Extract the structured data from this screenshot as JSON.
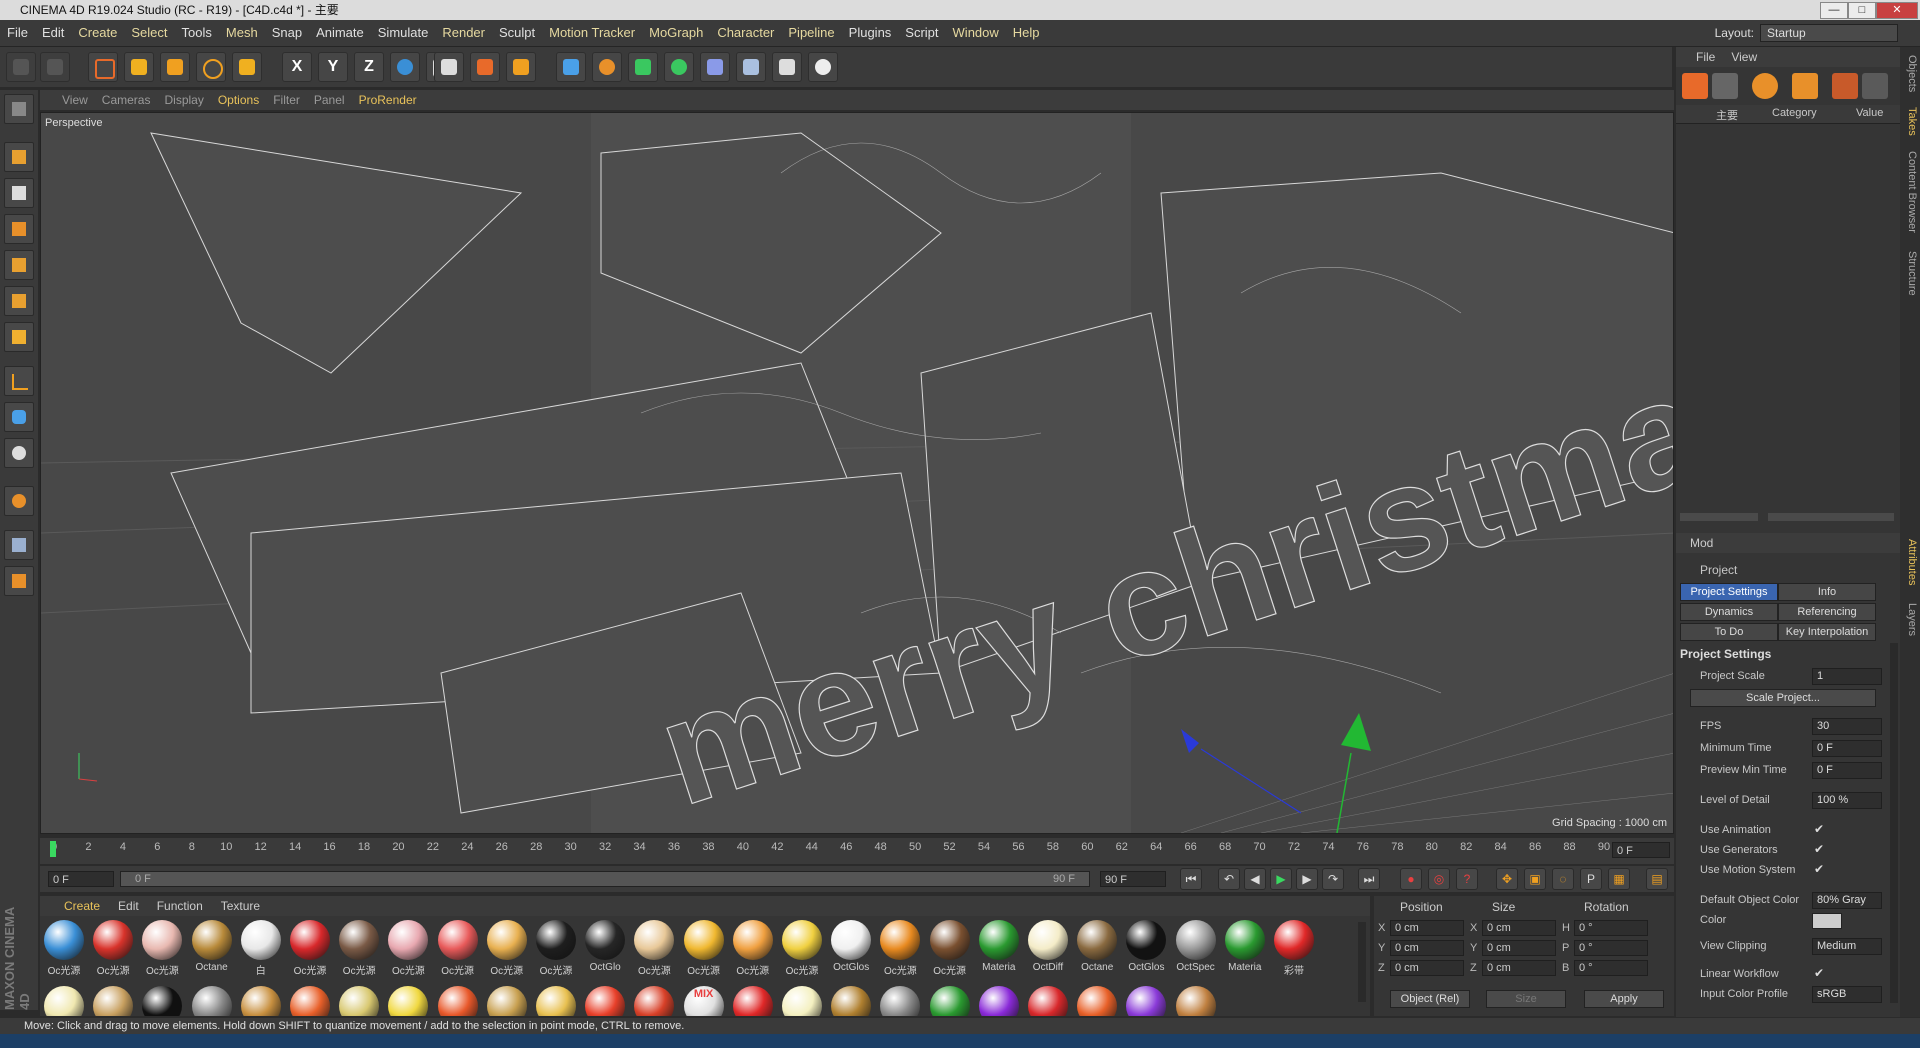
{
  "window": {
    "title": "CINEMA 4D R19.024 Studio (RC - R19) - [C4D.c4d *] - 主要",
    "controls": [
      "—",
      "□",
      "✕"
    ]
  },
  "menubar": {
    "items": [
      "File",
      "Edit",
      "Create",
      "Select",
      "Tools",
      "Mesh",
      "Snap",
      "Animate",
      "Simulate",
      "Render",
      "Sculpt",
      "Motion Tracker",
      "MoGraph",
      "Character",
      "Pipeline",
      "Plugins",
      "Script",
      "Window",
      "Help"
    ],
    "layout_label": "Layout:",
    "layout_value": "Startup"
  },
  "viewport": {
    "menu": [
      "View",
      "Cameras",
      "Display",
      "Options",
      "Filter",
      "Panel",
      "ProRender"
    ],
    "camera_label": "Perspective",
    "grid_spacing": "Grid Spacing : 1000 cm",
    "scene_text": "merry christmas"
  },
  "timeline": {
    "ticks": [
      "0",
      "2",
      "4",
      "6",
      "8",
      "10",
      "12",
      "14",
      "16",
      "18",
      "20",
      "22",
      "24",
      "26",
      "28",
      "30",
      "32",
      "34",
      "36",
      "38",
      "40",
      "42",
      "44",
      "46",
      "48",
      "50",
      "52",
      "54",
      "56",
      "58",
      "60",
      "62",
      "64",
      "66",
      "68",
      "70",
      "72",
      "74",
      "76",
      "78",
      "80",
      "82",
      "84",
      "86",
      "88",
      "90"
    ],
    "current_frame": "0 F"
  },
  "transport": {
    "start_frame": "0 F",
    "range_start": "0 F",
    "range_end": "90 F",
    "end_frame": "90 F"
  },
  "materials": {
    "menu": [
      "Create",
      "Edit",
      "Function",
      "Texture"
    ],
    "row1": [
      {
        "label": "Oc光源",
        "color": "#3a8fd6"
      },
      {
        "label": "Oc光源",
        "color": "#d8332b"
      },
      {
        "label": "Oc光源",
        "color": "#e8b8b0"
      },
      {
        "label": "Octane",
        "color": "#b88a3a"
      },
      {
        "label": "白",
        "color": "#e8e8e8"
      },
      {
        "label": "Oc光源",
        "color": "#d8282b"
      },
      {
        "label": "Oc光源",
        "color": "#7a5a46"
      },
      {
        "label": "Oc光源",
        "color": "#e8a8b0"
      },
      {
        "label": "Oc光源",
        "color": "#e85a5a"
      },
      {
        "label": "Oc光源",
        "color": "#e8b050"
      },
      {
        "label": "Oc光源",
        "color": "#1e1e1e"
      },
      {
        "label": "OctGlo",
        "color": "#262626"
      },
      {
        "label": "Oc光源",
        "color": "#e8c898"
      },
      {
        "label": "Oc光源",
        "color": "#f0b830"
      },
      {
        "label": "Oc光源",
        "color": "#f0a040"
      },
      {
        "label": "Oc光源",
        "color": "#f0d040"
      },
      {
        "label": "OctGlos",
        "color": "#f0f0f0"
      },
      {
        "label": "Oc光源",
        "color": "#e88a20"
      },
      {
        "label": "Oc光源",
        "color": "#7a5030"
      },
      {
        "label": "Materia",
        "color": "#2a9a30"
      },
      {
        "label": "OctDiff",
        "color": "#f4ecc8"
      },
      {
        "label": "Octane",
        "color": "#8a6a40"
      },
      {
        "label": "OctGlos",
        "color": "#121212"
      },
      {
        "label": "OctSpec",
        "color": "#9a9a9a"
      },
      {
        "label": "Materia",
        "color": "#2a9a30"
      },
      {
        "label": "彩带",
        "color": "#e02828"
      }
    ],
    "row2_colors": [
      "#f0e8b0",
      "#c8a060",
      "#101010",
      "#888888",
      "#c89040",
      "#e8602a",
      "#d8c870",
      "#f0d840",
      "#e8582a",
      "#c8a050",
      "#e8c050",
      "#e8402a",
      "#d84028",
      "#e0e0e0",
      "#e02828",
      "#f4f0c0",
      "#b08030",
      "#888888",
      "#2a9a30",
      "#8a2ad8",
      "#d8282b",
      "#e86028",
      "#8a3ad8",
      "#c08040"
    ],
    "row2_mix_label": "MIX"
  },
  "coords": {
    "headers": [
      "Position",
      "Size",
      "Rotation"
    ],
    "rows": [
      {
        "axis": "X",
        "pos": "0 cm",
        "size_axis": "X",
        "size": "0 cm",
        "rot_axis": "H",
        "rot": "0 °"
      },
      {
        "axis": "Y",
        "pos": "0 cm",
        "size_axis": "Y",
        "size": "0 cm",
        "rot_axis": "P",
        "rot": "0 °"
      },
      {
        "axis": "Z",
        "pos": "0 cm",
        "size_axis": "Z",
        "size": "0 cm",
        "rot_axis": "B",
        "rot": "0 °"
      }
    ],
    "mode": "Object (Rel)",
    "size_mode": "Size",
    "apply": "Apply"
  },
  "objects_panel": {
    "menu": [
      "File",
      "View"
    ],
    "columns": [
      "主要",
      "Category",
      "Value"
    ]
  },
  "attributes": {
    "menu": "Mod",
    "object": "Project",
    "tabs": [
      "Project Settings",
      "Info",
      "Dynamics",
      "Referencing",
      "To Do",
      "Key Interpolation"
    ],
    "section": "Project Settings",
    "project_scale_label": "Project Scale",
    "project_scale": "1",
    "scale_button": "Scale Project...",
    "fps_label": "FPS",
    "fps": "30",
    "min_time_label": "Minimum Time",
    "min_time": "0 F",
    "preview_min_label": "Preview Min Time",
    "preview_min": "0 F",
    "lod_label": "Level of Detail",
    "lod": "100 %",
    "use_animation": "Use Animation",
    "use_generators": "Use Generators",
    "use_motion": "Use Motion System",
    "default_color_label": "Default Object Color",
    "default_color": "80% Gray",
    "color_label": "Color",
    "view_clipping_label": "View Clipping",
    "view_clipping": "Medium",
    "linear_workflow": "Linear Workflow",
    "input_profile_label": "Input Color Profile",
    "input_profile": "sRGB",
    "check": "✔"
  },
  "side_tabs": [
    "Objects",
    "Takes",
    "Content Browser",
    "Structure",
    "Attributes",
    "Layers"
  ],
  "brand": "MAXON CINEMA 4D",
  "statusbar": {
    "text": "Move: Click and drag to move elements. Hold down SHIFT to quantize movement / add to the selection in point mode, CTRL to remove."
  }
}
